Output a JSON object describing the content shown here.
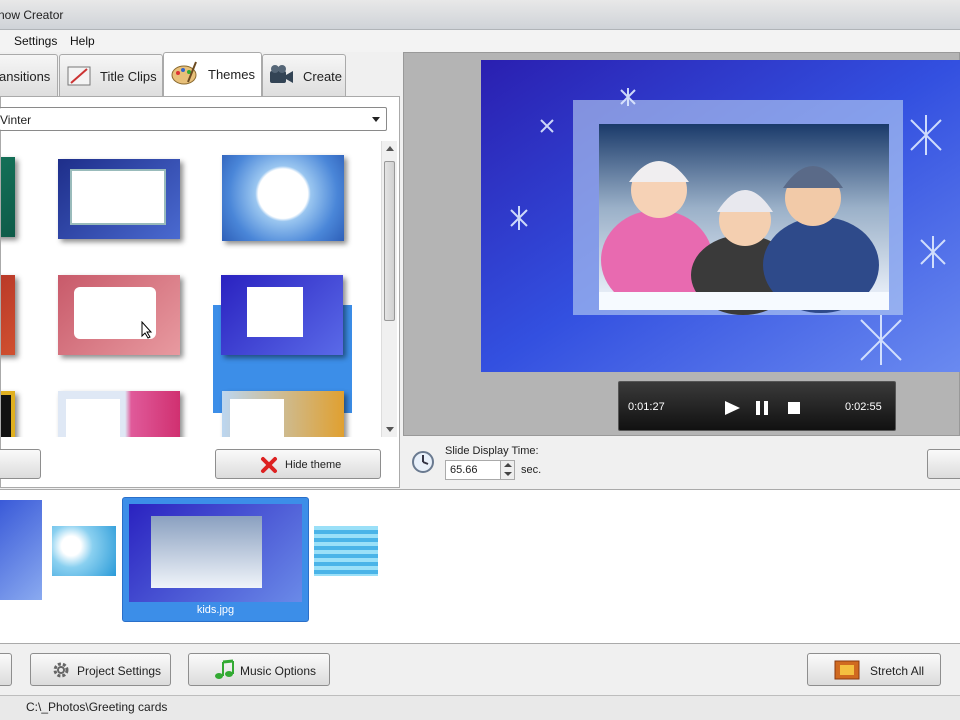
{
  "window": {
    "title": "now Creator"
  },
  "menu": {
    "items": [
      "Settings",
      "Help"
    ]
  },
  "tabs": [
    {
      "label": "ansitions",
      "icon": "transitions-icon"
    },
    {
      "label": "Title Clips",
      "icon": "title-clips-icon"
    },
    {
      "label": "Themes",
      "icon": "palette-icon",
      "active": true
    },
    {
      "label": "Create",
      "icon": "camcorder-icon"
    }
  ],
  "themes": {
    "category": "Vinter",
    "hide_theme_label": "Hide theme"
  },
  "preview": {
    "elapsed": "0:01:27",
    "total": "0:02:55"
  },
  "slide_display": {
    "label": "Slide Display Time:",
    "value": "65.66",
    "unit": "sec."
  },
  "timeline": {
    "selected_caption": "kids.jpg"
  },
  "toolbar": {
    "project_settings": "Project Settings",
    "music_options": "Music Options",
    "stretch_all": "Stretch All"
  },
  "status": {
    "path": "C:\\_Photos\\Greeting cards"
  },
  "colors": {
    "accent": "#3c8ee8",
    "preview_bg": "#1b1fc8"
  }
}
